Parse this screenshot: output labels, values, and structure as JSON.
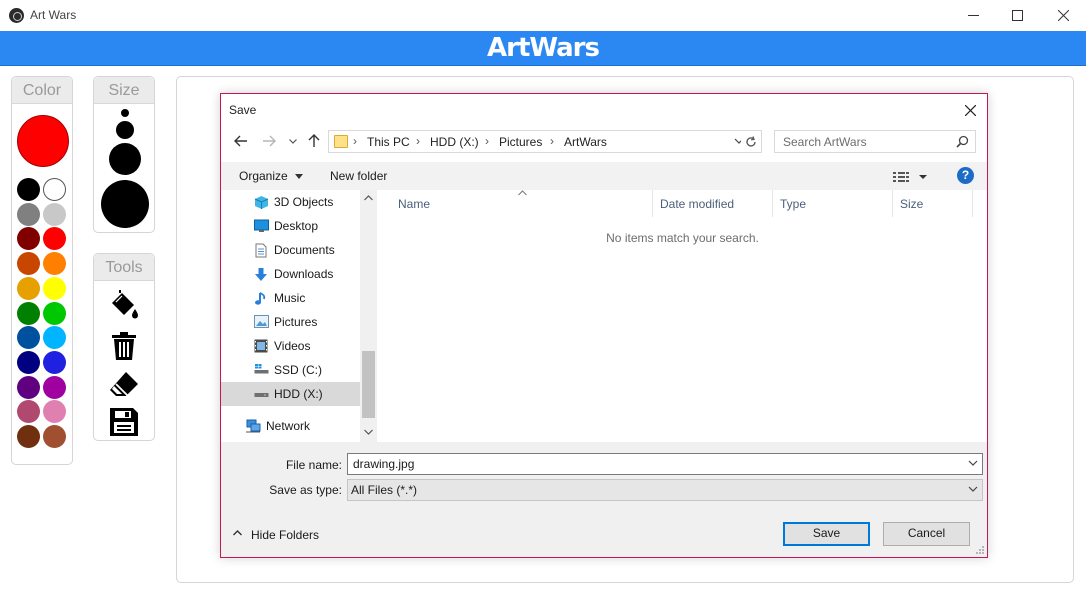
{
  "window": {
    "title": "Art Wars"
  },
  "banner": {
    "title": "ArtWars"
  },
  "panels": {
    "color_label": "Color",
    "size_label": "Size",
    "tools_label": "Tools"
  },
  "current_color": "#ff0000",
  "palette": [
    "#000000",
    "#ffffff",
    "#808080",
    "#c8c8c8",
    "#800000",
    "#ff0000",
    "#c84600",
    "#ff8000",
    "#e6a000",
    "#ffff00",
    "#008000",
    "#00c800",
    "#0050a0",
    "#00b4ff",
    "#000080",
    "#2020e0",
    "#600080",
    "#a000a0",
    "#b04870",
    "#e080b0",
    "#703010",
    "#a05030"
  ],
  "tools": [
    "paint-bucket-icon",
    "trash-icon",
    "eraser-icon",
    "save-icon"
  ],
  "dialog": {
    "title": "Save",
    "address": [
      "This PC",
      "HDD (X:)",
      "Pictures",
      "ArtWars"
    ],
    "search_placeholder": "Search ArtWars",
    "toolbar": {
      "organize": "Organize",
      "new_folder": "New folder"
    },
    "nav_items": [
      {
        "label": "3D Objects",
        "icon": "cube-icon"
      },
      {
        "label": "Desktop",
        "icon": "desktop-icon"
      },
      {
        "label": "Documents",
        "icon": "documents-icon"
      },
      {
        "label": "Downloads",
        "icon": "download-icon"
      },
      {
        "label": "Music",
        "icon": "music-icon"
      },
      {
        "label": "Pictures",
        "icon": "pictures-icon"
      },
      {
        "label": "Videos",
        "icon": "videos-icon"
      },
      {
        "label": "SSD (C:)",
        "icon": "drive-icon"
      },
      {
        "label": "HDD (X:)",
        "icon": "drive-icon",
        "selected": true
      },
      {
        "label": "Network",
        "icon": "network-icon"
      }
    ],
    "columns": [
      "Name",
      "Date modified",
      "Type",
      "Size"
    ],
    "empty_message": "No items match your search.",
    "file_name_label": "File name:",
    "file_name_value": "drawing.jpg",
    "save_type_label": "Save as type:",
    "save_type_value": "All Files (*.*)",
    "hide_folders": "Hide Folders",
    "save_button": "Save",
    "cancel_button": "Cancel"
  },
  "colors": {
    "accent": "#2b87f2",
    "dialog_border": "#c2185b",
    "primary_button": "#0078d7"
  }
}
